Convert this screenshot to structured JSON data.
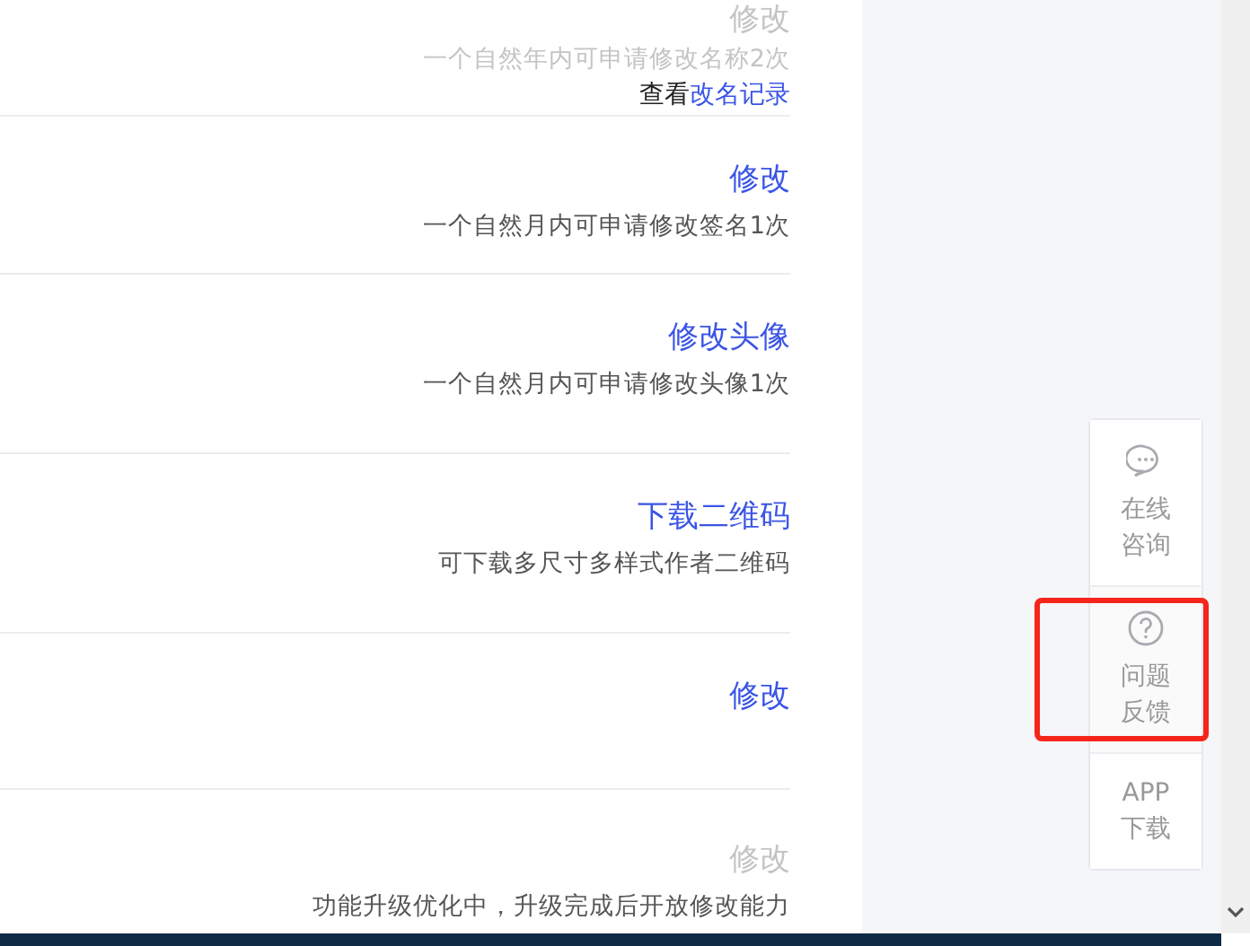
{
  "settings_rows": [
    {
      "action": "修改",
      "disabled": true,
      "description": "一个自然年内可申请修改名称2次",
      "note": "查看",
      "note_link": "改名记录"
    },
    {
      "action": "修改",
      "disabled": false,
      "description": "一个自然月内可申请修改签名1次"
    },
    {
      "action": "修改头像",
      "disabled": false,
      "description": "一个自然月内可申请修改头像1次"
    },
    {
      "action": "下载二维码",
      "disabled": false,
      "description": "可下载多尺寸多样式作者二维码"
    },
    {
      "action": "修改",
      "disabled": false
    },
    {
      "action": "修改",
      "disabled": true,
      "description": "功能升级优化中，升级完成后开放修改能力"
    }
  ],
  "float_panel": [
    {
      "kind": "chat",
      "lines": [
        "在线",
        "咨询"
      ],
      "highlighted": false
    },
    {
      "kind": "help",
      "lines": [
        "问题",
        "反馈"
      ],
      "highlighted": true
    },
    {
      "kind": "text",
      "lines": [
        "APP",
        "下载"
      ],
      "highlighted": false
    }
  ]
}
